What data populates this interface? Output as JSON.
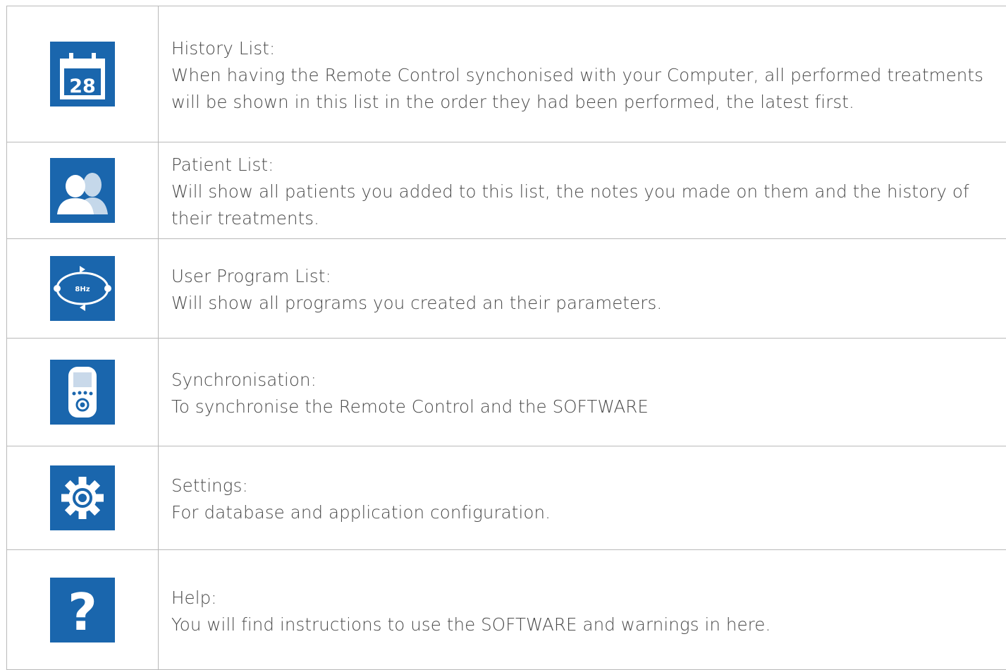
{
  "rows": [
    {
      "icon": "calendar-icon",
      "icon_text": "28",
      "title": "History List:",
      "description": "When having the Remote Control synchonised with your Computer, all performed treatments will be shown in this list in the order they had been performed, the latest first."
    },
    {
      "icon": "patients-icon",
      "title": "Patient List:",
      "description": "Will show all patients you added to this list, the notes you made on them and the history of their treatments."
    },
    {
      "icon": "program-cycle-icon",
      "icon_text": "8Hz",
      "title": "User Program List:",
      "description": "Will show all programs you created an their parameters."
    },
    {
      "icon": "remote-control-icon",
      "title": "Synchronisation:",
      "description": "To synchronise the Remote Control and the SOFTWARE"
    },
    {
      "icon": "gear-icon",
      "title": "Settings:",
      "description": "For database and application configuration."
    },
    {
      "icon": "question-mark-icon",
      "icon_text": "?",
      "title": "Help:",
      "description": "You will find instructions to use the SOFTWARE and warnings in here."
    }
  ],
  "colors": {
    "icon_background": "#1a66ad",
    "icon_foreground": "#ffffff",
    "text": "#4a4a4a",
    "border": "#b9b9b9"
  }
}
